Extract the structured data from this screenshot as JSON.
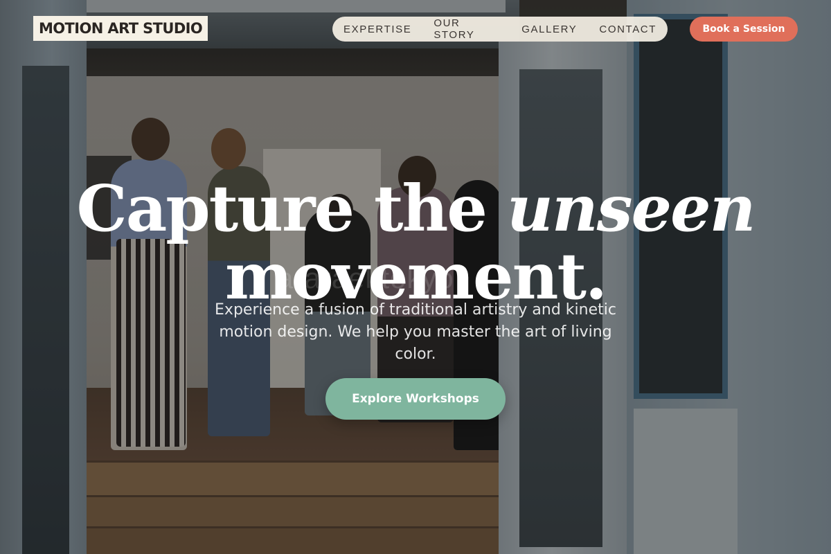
{
  "brand": {
    "logo_text": "MOTION ART STUDIO"
  },
  "nav": {
    "items": [
      {
        "label": "EXPERTISE"
      },
      {
        "label": "OUR STORY"
      },
      {
        "label": "GALLERY"
      },
      {
        "label": "CONTACT"
      }
    ],
    "cta_label": "Book a Session"
  },
  "hero": {
    "title_part1": "Capture the ",
    "title_emphasis": "unseen",
    "title_part2": "movement.",
    "subtitle": "Experience a fusion of traditional artistry and kinetic motion design. We help you master the art of living color.",
    "button_label": "Explore Workshops",
    "background_watermark": "ararael tokyo"
  },
  "colors": {
    "cta": "#e06f5a",
    "hero_button": "#7fb59e",
    "logo_bg": "#f6f1e6",
    "nav_bg": "#f6f1e6"
  }
}
